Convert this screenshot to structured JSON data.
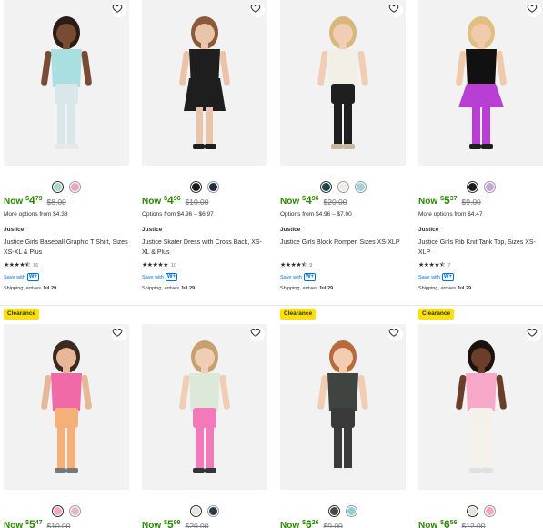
{
  "colors": {
    "price_green": "#2a8703",
    "link_blue": "#0071dc",
    "clearance_yellow": "#ffe000"
  },
  "products": [
    {
      "swatches": [
        "#a8d8c8",
        "#e7a6c9"
      ],
      "price": {
        "now": "Now",
        "currency": "$",
        "dollars": "4",
        "cents": "79",
        "was": "$8.00"
      },
      "options": "More options from $4.38",
      "brand": "Justice",
      "title": "Justice Girls Baseball Graphic T Shirt, Sizes XS-XL & Plus",
      "rating": {
        "stars": 4.5,
        "count": "16"
      },
      "save_with": "Save with",
      "wplus": "W+",
      "shipping_prefix": "Shipping, arrives",
      "shipping_date": "Jul 29"
    },
    {
      "swatches": [
        "#1c1c1c",
        "#222b4a"
      ],
      "price": {
        "now": "Now",
        "currency": "$",
        "dollars": "4",
        "cents": "96",
        "was": "$10.00"
      },
      "options": "Options from $4.96 – $6.97",
      "brand": "Justice",
      "title": "Justice Skater Dress with Cross Back, XS-XL & Plus",
      "rating": {
        "stars": 5,
        "count": "10"
      },
      "save_with": "Save with",
      "wplus": "W+",
      "shipping_prefix": "Shipping, arrives",
      "shipping_date": "Jul 29"
    },
    {
      "swatches": [
        "#1a4a4a",
        "#f0ece2",
        "#9dd4e0"
      ],
      "price": {
        "now": "Now",
        "currency": "$",
        "dollars": "4",
        "cents": "96",
        "was": "$20.00"
      },
      "options": "Options from $4.96 – $7.00",
      "brand": "Justice",
      "title": "Justice Girls Block Romper, Sizes XS-XLP",
      "rating": {
        "stars": 4.5,
        "count": "9"
      },
      "save_with": "Save with",
      "wplus": "W+",
      "shipping_prefix": "Shipping, arrives",
      "shipping_date": "Jul 29"
    },
    {
      "swatches": [
        "#1c1c1c",
        "#c8a2e0"
      ],
      "price": {
        "now": "Now",
        "currency": "$",
        "dollars": "5",
        "cents": "37",
        "was": "$9.00"
      },
      "options": "More options from $4.47",
      "brand": "Justice",
      "title": "Justice Girls Rib Knit Tank Top, Sizes XS-XLP",
      "rating": {
        "stars": 4.5,
        "count": "7"
      },
      "save_with": "Save with",
      "wplus": "W+",
      "shipping_prefix": "Shipping, arrives",
      "shipping_date": "Jul 29"
    },
    {
      "clearance": "Clearance",
      "swatches": [
        "#f3a5c4",
        "#e8b8c8"
      ],
      "price": {
        "now": "Now",
        "currency": "$",
        "dollars": "5",
        "cents": "47",
        "was": "$10.00"
      }
    },
    {
      "swatches": [
        "#dfe8dc",
        "#2b3a4a"
      ],
      "price": {
        "now": "Now",
        "currency": "$",
        "dollars": "5",
        "cents": "99",
        "was": "$20.00"
      }
    },
    {
      "clearance": "Clearance",
      "swatches": [
        "#4a4a4a",
        "#8fd0d8"
      ],
      "price": {
        "now": "Now",
        "currency": "$",
        "dollars": "6",
        "cents": "26",
        "was": "$9.00"
      }
    },
    {
      "clearance": "Clearance",
      "swatches": [
        "#e8e4dc",
        "#f4a8c4"
      ],
      "price": {
        "now": "Now",
        "currency": "$",
        "dollars": "6",
        "cents": "56",
        "was": "$12.00"
      }
    }
  ]
}
